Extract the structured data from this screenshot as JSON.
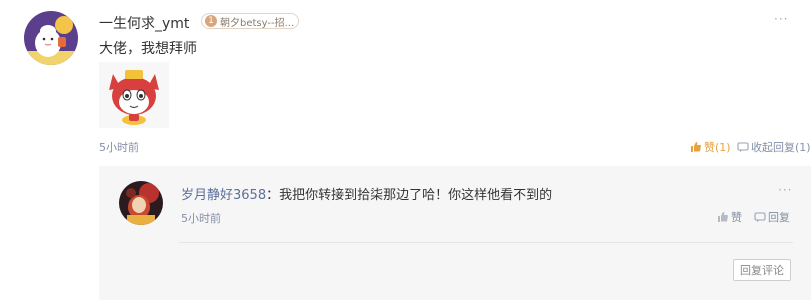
{
  "comment": {
    "username": "一生何求_ymt",
    "fan_badge": {
      "level": "1",
      "name": "朝夕betsy--招..."
    },
    "text": "大佬，我想拜师",
    "time": "5小时前",
    "like_label": "赞",
    "like_count": "(1)",
    "collapse_label": "收起回复(1)",
    "more": "···"
  },
  "reply": {
    "username": "岁月静好3658",
    "separator": "：",
    "text": "我把你转接到拾柒那边了哈！你这样他看不到的",
    "time": "5小时前",
    "like_label": "赞",
    "reply_label": "回复",
    "more": "···",
    "reply_button": "回复评论"
  },
  "colors": {
    "accent_like": "#e6a23c",
    "link_user": "#5a6f9a",
    "muted": "#8590a6"
  }
}
